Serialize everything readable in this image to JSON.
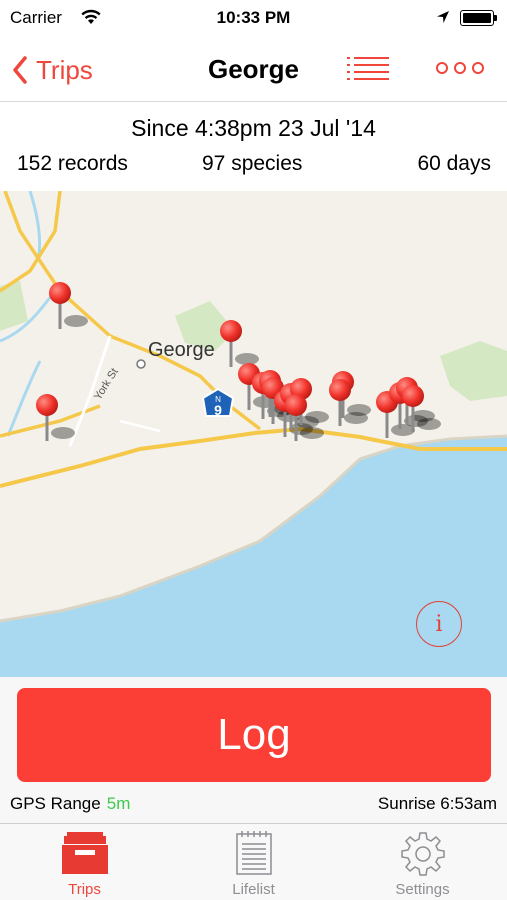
{
  "status_bar": {
    "carrier": "Carrier",
    "time": "10:33 PM",
    "icons": [
      "wifi-icon",
      "location-arrow-icon",
      "battery-icon"
    ]
  },
  "nav": {
    "back_label": "Trips",
    "title": "George",
    "icons": [
      "chevron-left-icon",
      "list-icon",
      "more-icon"
    ],
    "accent_color": "#f0463c"
  },
  "summary": {
    "since": "Since 4:38pm 23 Jul '14",
    "records": "152 records",
    "species": "97 species",
    "days": "60 days"
  },
  "map": {
    "place_label": "George",
    "street_label": "York St",
    "route_shield": "9",
    "route_shield_letter": "N",
    "pin_color": "#f0322a",
    "water_color": "#a9d9f0",
    "info_label": "i"
  },
  "log": {
    "button_label": "Log",
    "button_color": "#fb3e36",
    "gps_label": "GPS Range",
    "gps_value": "5m",
    "gps_value_color": "#3fc94d",
    "sunrise": "Sunrise 6:53am"
  },
  "tabs": [
    {
      "label": "Trips",
      "icon": "trips-icon",
      "active": true
    },
    {
      "label": "Lifelist",
      "icon": "notepad-icon",
      "active": false
    },
    {
      "label": "Settings",
      "icon": "gear-icon",
      "active": false
    }
  ]
}
